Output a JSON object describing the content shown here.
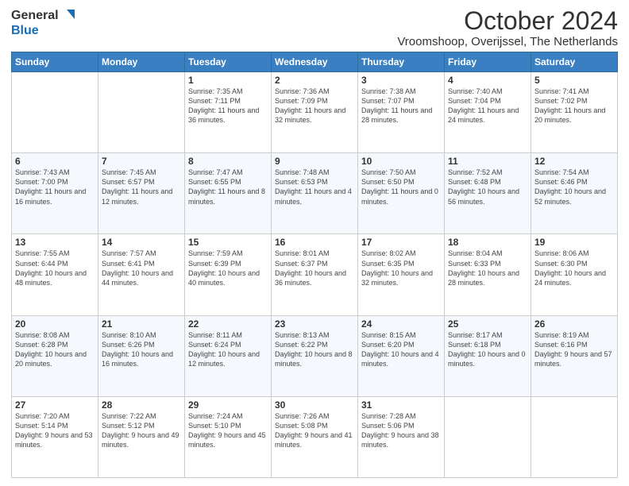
{
  "header": {
    "logo_general": "General",
    "logo_blue": "Blue",
    "month_title": "October 2024",
    "location": "Vroomshoop, Overijssel, The Netherlands"
  },
  "days_of_week": [
    "Sunday",
    "Monday",
    "Tuesday",
    "Wednesday",
    "Thursday",
    "Friday",
    "Saturday"
  ],
  "weeks": [
    [
      {
        "day": "",
        "info": ""
      },
      {
        "day": "",
        "info": ""
      },
      {
        "day": "1",
        "info": "Sunrise: 7:35 AM\nSunset: 7:11 PM\nDaylight: 11 hours and 36 minutes."
      },
      {
        "day": "2",
        "info": "Sunrise: 7:36 AM\nSunset: 7:09 PM\nDaylight: 11 hours and 32 minutes."
      },
      {
        "day": "3",
        "info": "Sunrise: 7:38 AM\nSunset: 7:07 PM\nDaylight: 11 hours and 28 minutes."
      },
      {
        "day": "4",
        "info": "Sunrise: 7:40 AM\nSunset: 7:04 PM\nDaylight: 11 hours and 24 minutes."
      },
      {
        "day": "5",
        "info": "Sunrise: 7:41 AM\nSunset: 7:02 PM\nDaylight: 11 hours and 20 minutes."
      }
    ],
    [
      {
        "day": "6",
        "info": "Sunrise: 7:43 AM\nSunset: 7:00 PM\nDaylight: 11 hours and 16 minutes."
      },
      {
        "day": "7",
        "info": "Sunrise: 7:45 AM\nSunset: 6:57 PM\nDaylight: 11 hours and 12 minutes."
      },
      {
        "day": "8",
        "info": "Sunrise: 7:47 AM\nSunset: 6:55 PM\nDaylight: 11 hours and 8 minutes."
      },
      {
        "day": "9",
        "info": "Sunrise: 7:48 AM\nSunset: 6:53 PM\nDaylight: 11 hours and 4 minutes."
      },
      {
        "day": "10",
        "info": "Sunrise: 7:50 AM\nSunset: 6:50 PM\nDaylight: 11 hours and 0 minutes."
      },
      {
        "day": "11",
        "info": "Sunrise: 7:52 AM\nSunset: 6:48 PM\nDaylight: 10 hours and 56 minutes."
      },
      {
        "day": "12",
        "info": "Sunrise: 7:54 AM\nSunset: 6:46 PM\nDaylight: 10 hours and 52 minutes."
      }
    ],
    [
      {
        "day": "13",
        "info": "Sunrise: 7:55 AM\nSunset: 6:44 PM\nDaylight: 10 hours and 48 minutes."
      },
      {
        "day": "14",
        "info": "Sunrise: 7:57 AM\nSunset: 6:41 PM\nDaylight: 10 hours and 44 minutes."
      },
      {
        "day": "15",
        "info": "Sunrise: 7:59 AM\nSunset: 6:39 PM\nDaylight: 10 hours and 40 minutes."
      },
      {
        "day": "16",
        "info": "Sunrise: 8:01 AM\nSunset: 6:37 PM\nDaylight: 10 hours and 36 minutes."
      },
      {
        "day": "17",
        "info": "Sunrise: 8:02 AM\nSunset: 6:35 PM\nDaylight: 10 hours and 32 minutes."
      },
      {
        "day": "18",
        "info": "Sunrise: 8:04 AM\nSunset: 6:33 PM\nDaylight: 10 hours and 28 minutes."
      },
      {
        "day": "19",
        "info": "Sunrise: 8:06 AM\nSunset: 6:30 PM\nDaylight: 10 hours and 24 minutes."
      }
    ],
    [
      {
        "day": "20",
        "info": "Sunrise: 8:08 AM\nSunset: 6:28 PM\nDaylight: 10 hours and 20 minutes."
      },
      {
        "day": "21",
        "info": "Sunrise: 8:10 AM\nSunset: 6:26 PM\nDaylight: 10 hours and 16 minutes."
      },
      {
        "day": "22",
        "info": "Sunrise: 8:11 AM\nSunset: 6:24 PM\nDaylight: 10 hours and 12 minutes."
      },
      {
        "day": "23",
        "info": "Sunrise: 8:13 AM\nSunset: 6:22 PM\nDaylight: 10 hours and 8 minutes."
      },
      {
        "day": "24",
        "info": "Sunrise: 8:15 AM\nSunset: 6:20 PM\nDaylight: 10 hours and 4 minutes."
      },
      {
        "day": "25",
        "info": "Sunrise: 8:17 AM\nSunset: 6:18 PM\nDaylight: 10 hours and 0 minutes."
      },
      {
        "day": "26",
        "info": "Sunrise: 8:19 AM\nSunset: 6:16 PM\nDaylight: 9 hours and 57 minutes."
      }
    ],
    [
      {
        "day": "27",
        "info": "Sunrise: 7:20 AM\nSunset: 5:14 PM\nDaylight: 9 hours and 53 minutes."
      },
      {
        "day": "28",
        "info": "Sunrise: 7:22 AM\nSunset: 5:12 PM\nDaylight: 9 hours and 49 minutes."
      },
      {
        "day": "29",
        "info": "Sunrise: 7:24 AM\nSunset: 5:10 PM\nDaylight: 9 hours and 45 minutes."
      },
      {
        "day": "30",
        "info": "Sunrise: 7:26 AM\nSunset: 5:08 PM\nDaylight: 9 hours and 41 minutes."
      },
      {
        "day": "31",
        "info": "Sunrise: 7:28 AM\nSunset: 5:06 PM\nDaylight: 9 hours and 38 minutes."
      },
      {
        "day": "",
        "info": ""
      },
      {
        "day": "",
        "info": ""
      }
    ]
  ]
}
